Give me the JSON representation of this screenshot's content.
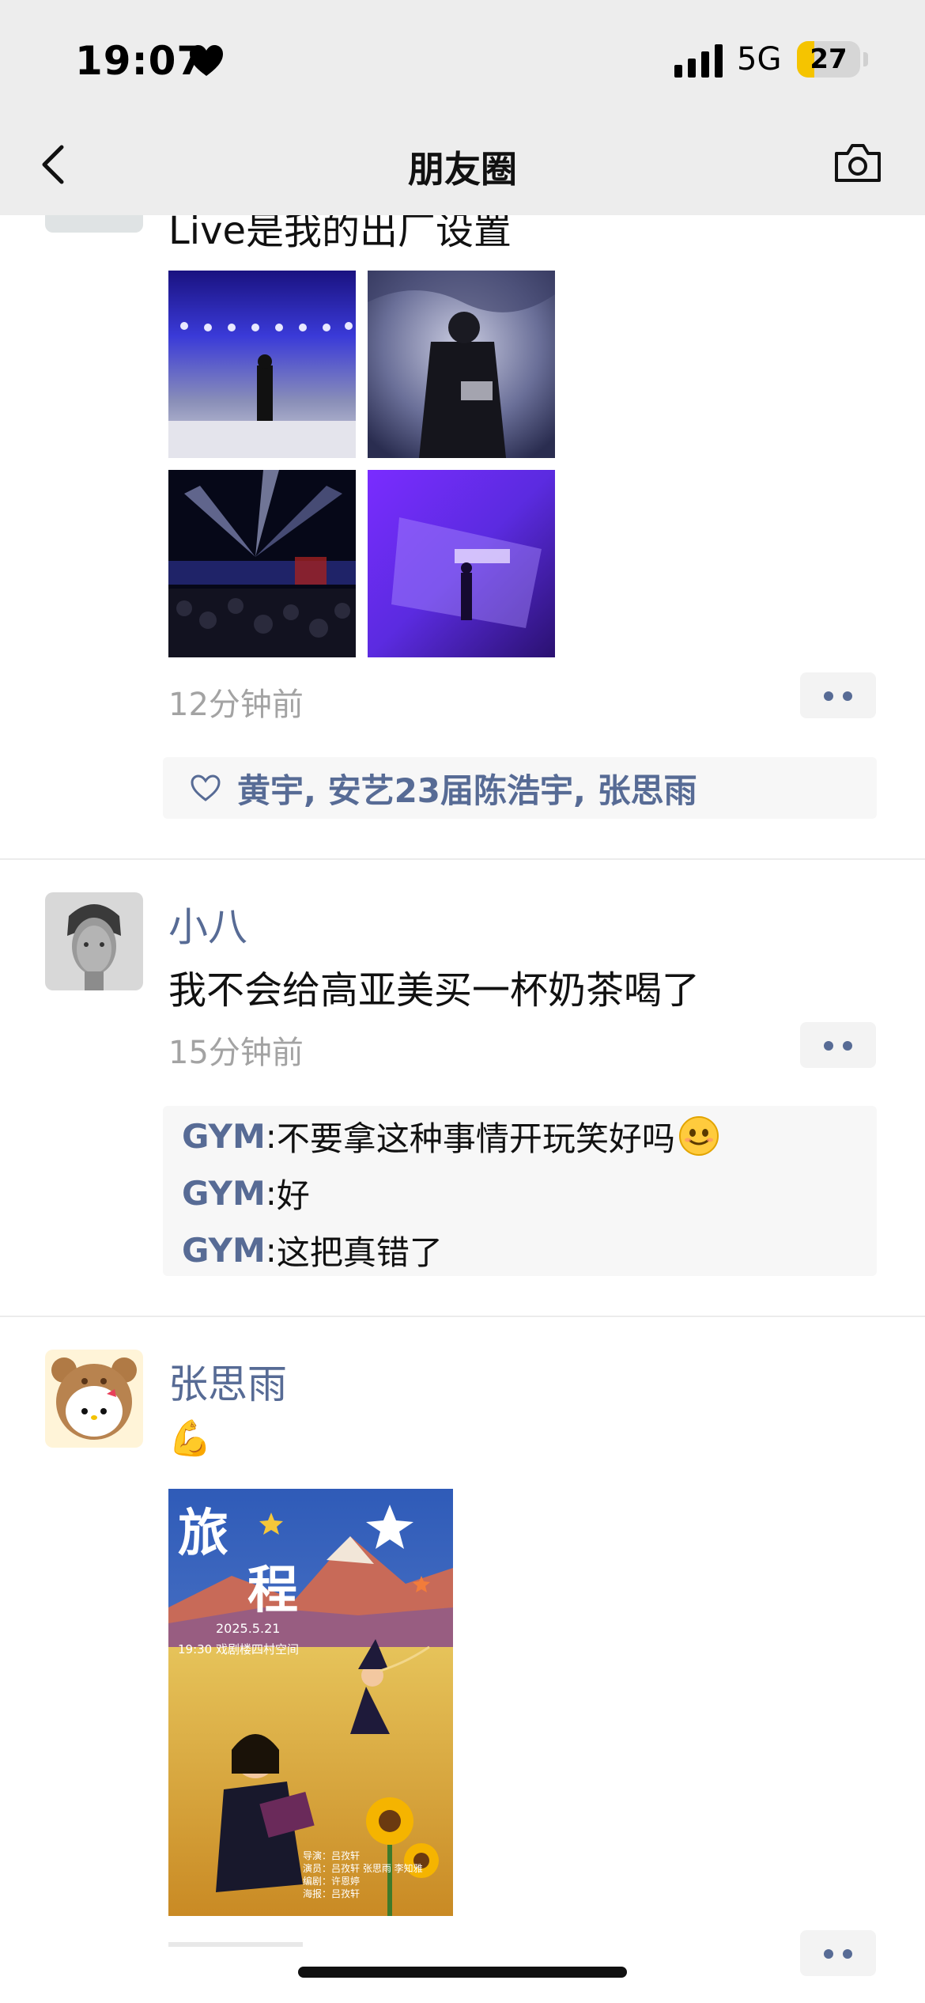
{
  "status_bar": {
    "time": "19:07",
    "network": "5G",
    "battery": "27",
    "battery_level": 0.27
  },
  "nav": {
    "title": "朋友圈"
  },
  "post1": {
    "text_partial": "Live是我的出厂设置",
    "time": "12分钟前",
    "likes": "黄宇, 安艺23届陈浩宇, 张思雨"
  },
  "post2": {
    "author": "小八",
    "text": "我不会给高亚美买一杯奶茶喝了",
    "time": "15分钟前",
    "comments": [
      {
        "author": "GYM",
        "text": "不要拿这种事情开玩笑好吗"
      },
      {
        "author": "GYM",
        "text": "好"
      },
      {
        "author": "GYM",
        "text": "这把真错了"
      }
    ]
  },
  "post3": {
    "author": "张思雨",
    "emoji": "💪",
    "poster": {
      "title_line1": "旅",
      "title_line2": "程",
      "date": "2025.5.21",
      "time_venue": "19:30  戏剧楼四村空间",
      "credits": [
        "导演：吕孜轩",
        "演员：吕孜轩 张思雨 李知雅",
        "编剧：许恩婷",
        "海报：吕孜轩"
      ]
    }
  }
}
